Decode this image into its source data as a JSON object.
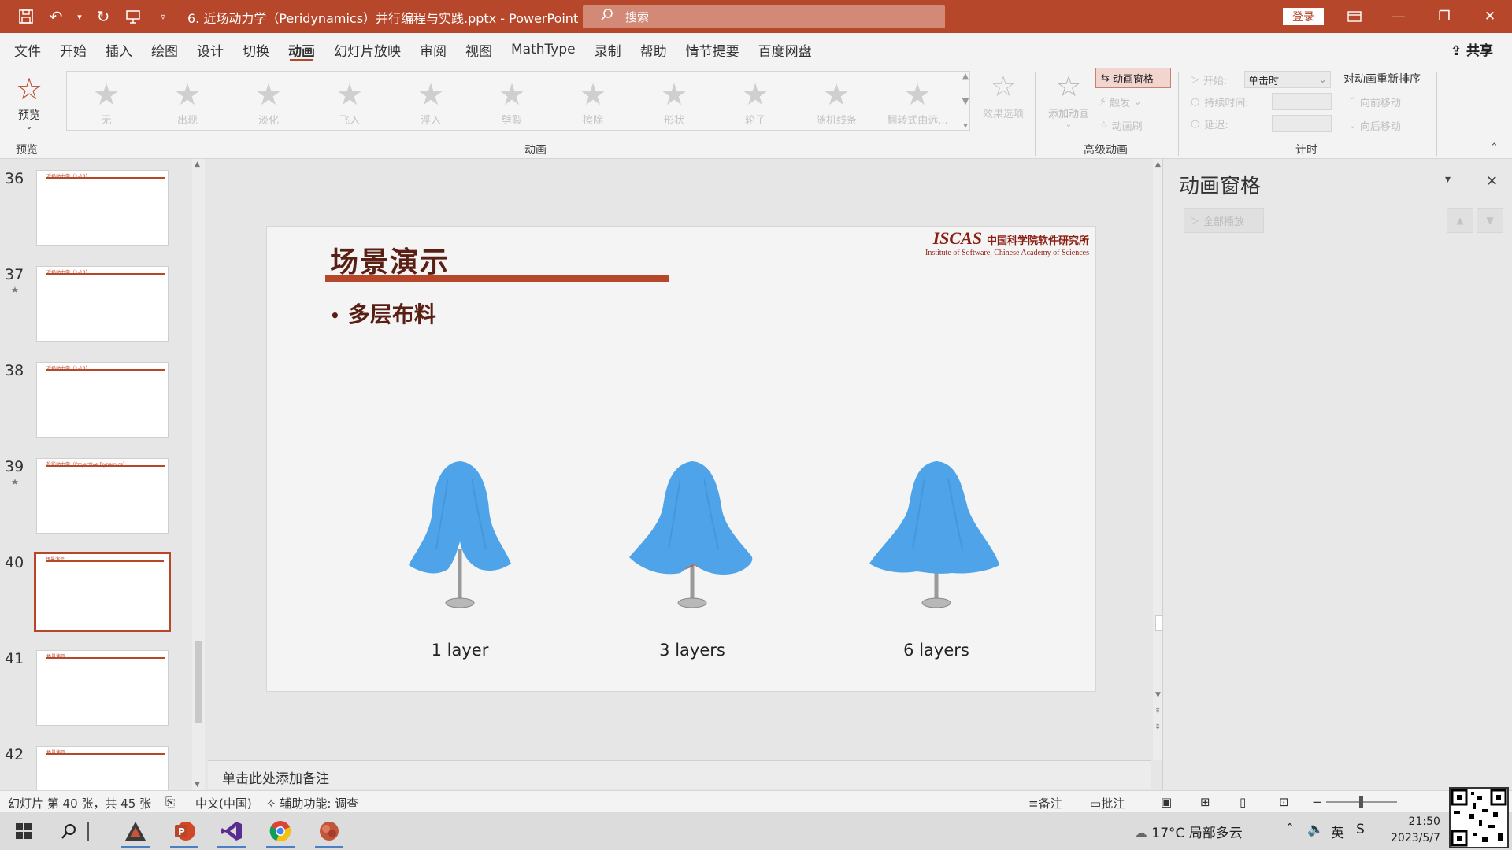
{
  "window": {
    "doc_title": "6. 近场动力学（Peridynamics）并行编程与实践.pptx  -  PowerPoint",
    "search_placeholder": "搜索",
    "login_label": "登录"
  },
  "ribbon_tabs": [
    "文件",
    "开始",
    "插入",
    "绘图",
    "设计",
    "切换",
    "动画",
    "幻灯片放映",
    "审阅",
    "视图",
    "MathType",
    "录制",
    "帮助",
    "情节提要",
    "百度网盘"
  ],
  "active_tab": "动画",
  "share_label": "共享",
  "ribbon": {
    "preview_label": "预览",
    "preview_group": "预览",
    "animation_group": "动画",
    "advanced_group": "高级动画",
    "timing_group": "计时",
    "animations": [
      "无",
      "出现",
      "淡化",
      "飞入",
      "浮入",
      "劈裂",
      "擦除",
      "形状",
      "轮子",
      "随机线条",
      "翻转式由远..."
    ],
    "effect_options": "效果选项",
    "add_animation": "添加动画",
    "animation_pane_btn": "动画窗格",
    "trigger": "触发",
    "anim_painter": "动画刷",
    "start_label": "开始:",
    "start_value": "单击时",
    "duration_label": "持续时间:",
    "delay_label": "延迟:",
    "reorder_title": "对动画重新排序",
    "move_earlier": "向前移动",
    "move_later": "向后移动"
  },
  "thumbnails": [
    {
      "num": "36",
      "star": false,
      "title": "近场动力学（1-18）"
    },
    {
      "num": "37",
      "star": true,
      "title": "近场动力学（1-18）"
    },
    {
      "num": "38",
      "star": false,
      "title": "近场动力学（1-18）"
    },
    {
      "num": "39",
      "star": true,
      "title": "投影动力学（Projective Dynamics）"
    },
    {
      "num": "40",
      "star": false,
      "title": "场景演示",
      "selected": true
    },
    {
      "num": "41",
      "star": false,
      "title": "场景演示"
    },
    {
      "num": "42",
      "star": false,
      "title": "场景演示"
    }
  ],
  "slide": {
    "title": "场景演示",
    "bullet": "多层布料",
    "logo_text": "ISCAS",
    "logo_cn": "中国科学院软件研究所",
    "logo_en": "Institute of Software, Chinese Academy of Sciences",
    "figures": [
      {
        "label": "1 layer"
      },
      {
        "label": "3 layers"
      },
      {
        "label": "6 layers"
      }
    ]
  },
  "notes_placeholder": "单击此处添加备注",
  "anim_pane": {
    "title": "动画窗格",
    "play_all": "全部播放"
  },
  "status": {
    "slide_info": "幻灯片 第 40 张，共 45 张",
    "language": "中文(中国)",
    "accessibility": "辅助功能: 调查",
    "notes_btn": "备注",
    "comments_btn": "批注"
  },
  "taskbar": {
    "weather": "17°C  局部多云",
    "ime": "英",
    "time": "21:50",
    "date": "2023/5/7"
  },
  "colors": {
    "accent": "#b7472a",
    "cloth_blue": "#4fa3e8",
    "cloth_red": "#c0553a"
  }
}
